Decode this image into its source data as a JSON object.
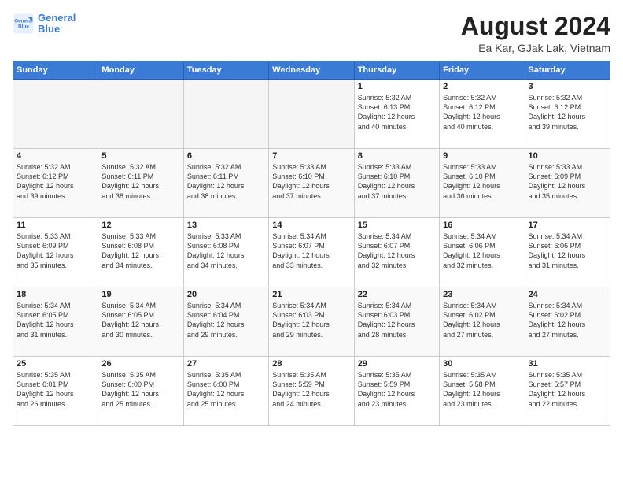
{
  "header": {
    "logo_line1": "General",
    "logo_line2": "Blue",
    "title": "August 2024",
    "subtitle": "Ea Kar, GJak Lak, Vietnam"
  },
  "days_of_week": [
    "Sunday",
    "Monday",
    "Tuesday",
    "Wednesday",
    "Thursday",
    "Friday",
    "Saturday"
  ],
  "weeks": [
    [
      {
        "day": "",
        "info": ""
      },
      {
        "day": "",
        "info": ""
      },
      {
        "day": "",
        "info": ""
      },
      {
        "day": "",
        "info": ""
      },
      {
        "day": "1",
        "info": "Sunrise: 5:32 AM\nSunset: 6:13 PM\nDaylight: 12 hours\nand 40 minutes."
      },
      {
        "day": "2",
        "info": "Sunrise: 5:32 AM\nSunset: 6:12 PM\nDaylight: 12 hours\nand 40 minutes."
      },
      {
        "day": "3",
        "info": "Sunrise: 5:32 AM\nSunset: 6:12 PM\nDaylight: 12 hours\nand 39 minutes."
      }
    ],
    [
      {
        "day": "4",
        "info": "Sunrise: 5:32 AM\nSunset: 6:12 PM\nDaylight: 12 hours\nand 39 minutes."
      },
      {
        "day": "5",
        "info": "Sunrise: 5:32 AM\nSunset: 6:11 PM\nDaylight: 12 hours\nand 38 minutes."
      },
      {
        "day": "6",
        "info": "Sunrise: 5:32 AM\nSunset: 6:11 PM\nDaylight: 12 hours\nand 38 minutes."
      },
      {
        "day": "7",
        "info": "Sunrise: 5:33 AM\nSunset: 6:10 PM\nDaylight: 12 hours\nand 37 minutes."
      },
      {
        "day": "8",
        "info": "Sunrise: 5:33 AM\nSunset: 6:10 PM\nDaylight: 12 hours\nand 37 minutes."
      },
      {
        "day": "9",
        "info": "Sunrise: 5:33 AM\nSunset: 6:10 PM\nDaylight: 12 hours\nand 36 minutes."
      },
      {
        "day": "10",
        "info": "Sunrise: 5:33 AM\nSunset: 6:09 PM\nDaylight: 12 hours\nand 35 minutes."
      }
    ],
    [
      {
        "day": "11",
        "info": "Sunrise: 5:33 AM\nSunset: 6:09 PM\nDaylight: 12 hours\nand 35 minutes."
      },
      {
        "day": "12",
        "info": "Sunrise: 5:33 AM\nSunset: 6:08 PM\nDaylight: 12 hours\nand 34 minutes."
      },
      {
        "day": "13",
        "info": "Sunrise: 5:33 AM\nSunset: 6:08 PM\nDaylight: 12 hours\nand 34 minutes."
      },
      {
        "day": "14",
        "info": "Sunrise: 5:34 AM\nSunset: 6:07 PM\nDaylight: 12 hours\nand 33 minutes."
      },
      {
        "day": "15",
        "info": "Sunrise: 5:34 AM\nSunset: 6:07 PM\nDaylight: 12 hours\nand 32 minutes."
      },
      {
        "day": "16",
        "info": "Sunrise: 5:34 AM\nSunset: 6:06 PM\nDaylight: 12 hours\nand 32 minutes."
      },
      {
        "day": "17",
        "info": "Sunrise: 5:34 AM\nSunset: 6:06 PM\nDaylight: 12 hours\nand 31 minutes."
      }
    ],
    [
      {
        "day": "18",
        "info": "Sunrise: 5:34 AM\nSunset: 6:05 PM\nDaylight: 12 hours\nand 31 minutes."
      },
      {
        "day": "19",
        "info": "Sunrise: 5:34 AM\nSunset: 6:05 PM\nDaylight: 12 hours\nand 30 minutes."
      },
      {
        "day": "20",
        "info": "Sunrise: 5:34 AM\nSunset: 6:04 PM\nDaylight: 12 hours\nand 29 minutes."
      },
      {
        "day": "21",
        "info": "Sunrise: 5:34 AM\nSunset: 6:03 PM\nDaylight: 12 hours\nand 29 minutes."
      },
      {
        "day": "22",
        "info": "Sunrise: 5:34 AM\nSunset: 6:03 PM\nDaylight: 12 hours\nand 28 minutes."
      },
      {
        "day": "23",
        "info": "Sunrise: 5:34 AM\nSunset: 6:02 PM\nDaylight: 12 hours\nand 27 minutes."
      },
      {
        "day": "24",
        "info": "Sunrise: 5:34 AM\nSunset: 6:02 PM\nDaylight: 12 hours\nand 27 minutes."
      }
    ],
    [
      {
        "day": "25",
        "info": "Sunrise: 5:35 AM\nSunset: 6:01 PM\nDaylight: 12 hours\nand 26 minutes."
      },
      {
        "day": "26",
        "info": "Sunrise: 5:35 AM\nSunset: 6:00 PM\nDaylight: 12 hours\nand 25 minutes."
      },
      {
        "day": "27",
        "info": "Sunrise: 5:35 AM\nSunset: 6:00 PM\nDaylight: 12 hours\nand 25 minutes."
      },
      {
        "day": "28",
        "info": "Sunrise: 5:35 AM\nSunset: 5:59 PM\nDaylight: 12 hours\nand 24 minutes."
      },
      {
        "day": "29",
        "info": "Sunrise: 5:35 AM\nSunset: 5:59 PM\nDaylight: 12 hours\nand 23 minutes."
      },
      {
        "day": "30",
        "info": "Sunrise: 5:35 AM\nSunset: 5:58 PM\nDaylight: 12 hours\nand 23 minutes."
      },
      {
        "day": "31",
        "info": "Sunrise: 5:35 AM\nSunset: 5:57 PM\nDaylight: 12 hours\nand 22 minutes."
      }
    ]
  ]
}
